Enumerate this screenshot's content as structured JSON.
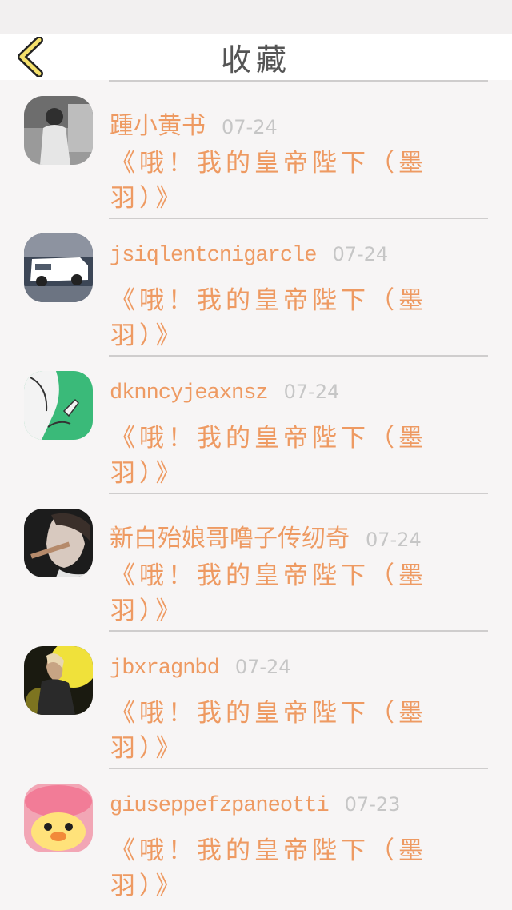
{
  "header": {
    "title": "收藏"
  },
  "items": [
    {
      "username": "踵小黄书",
      "date": "07-24",
      "book_title": "《哦！我的皇帝陛下（墨羽）》",
      "avatar": "avatar-girl-grayscale"
    },
    {
      "username": "jsiqlentcnigarcle",
      "date": "07-24",
      "book_title": "《哦！我的皇帝陛下（墨羽）》",
      "avatar": "avatar-white-car"
    },
    {
      "username": "dknncyjeaxnsz",
      "date": "07-24",
      "book_title": "《哦！我的皇帝陛下（墨羽）》",
      "avatar": "avatar-anime-green"
    },
    {
      "username": "新白殆娘哥噜子传纫奇",
      "date": "07-24",
      "book_title": "《哦！我的皇帝陛下（墨羽）》",
      "avatar": "avatar-dark-portrait"
    },
    {
      "username": "jbxragnbd",
      "date": "07-24",
      "book_title": "《哦！我的皇帝陛下（墨羽）》",
      "avatar": "avatar-stage-singer"
    },
    {
      "username": "giuseppefzpaneotti",
      "date": "07-23",
      "book_title": "《哦！我的皇帝陛下（墨羽）》",
      "avatar": "avatar-pink-duck"
    }
  ],
  "colors": {
    "accent": "#ee9a62",
    "back_arrow_fill": "#f5e16b",
    "date": "#c6c6c6",
    "background": "#f7f5f5"
  }
}
